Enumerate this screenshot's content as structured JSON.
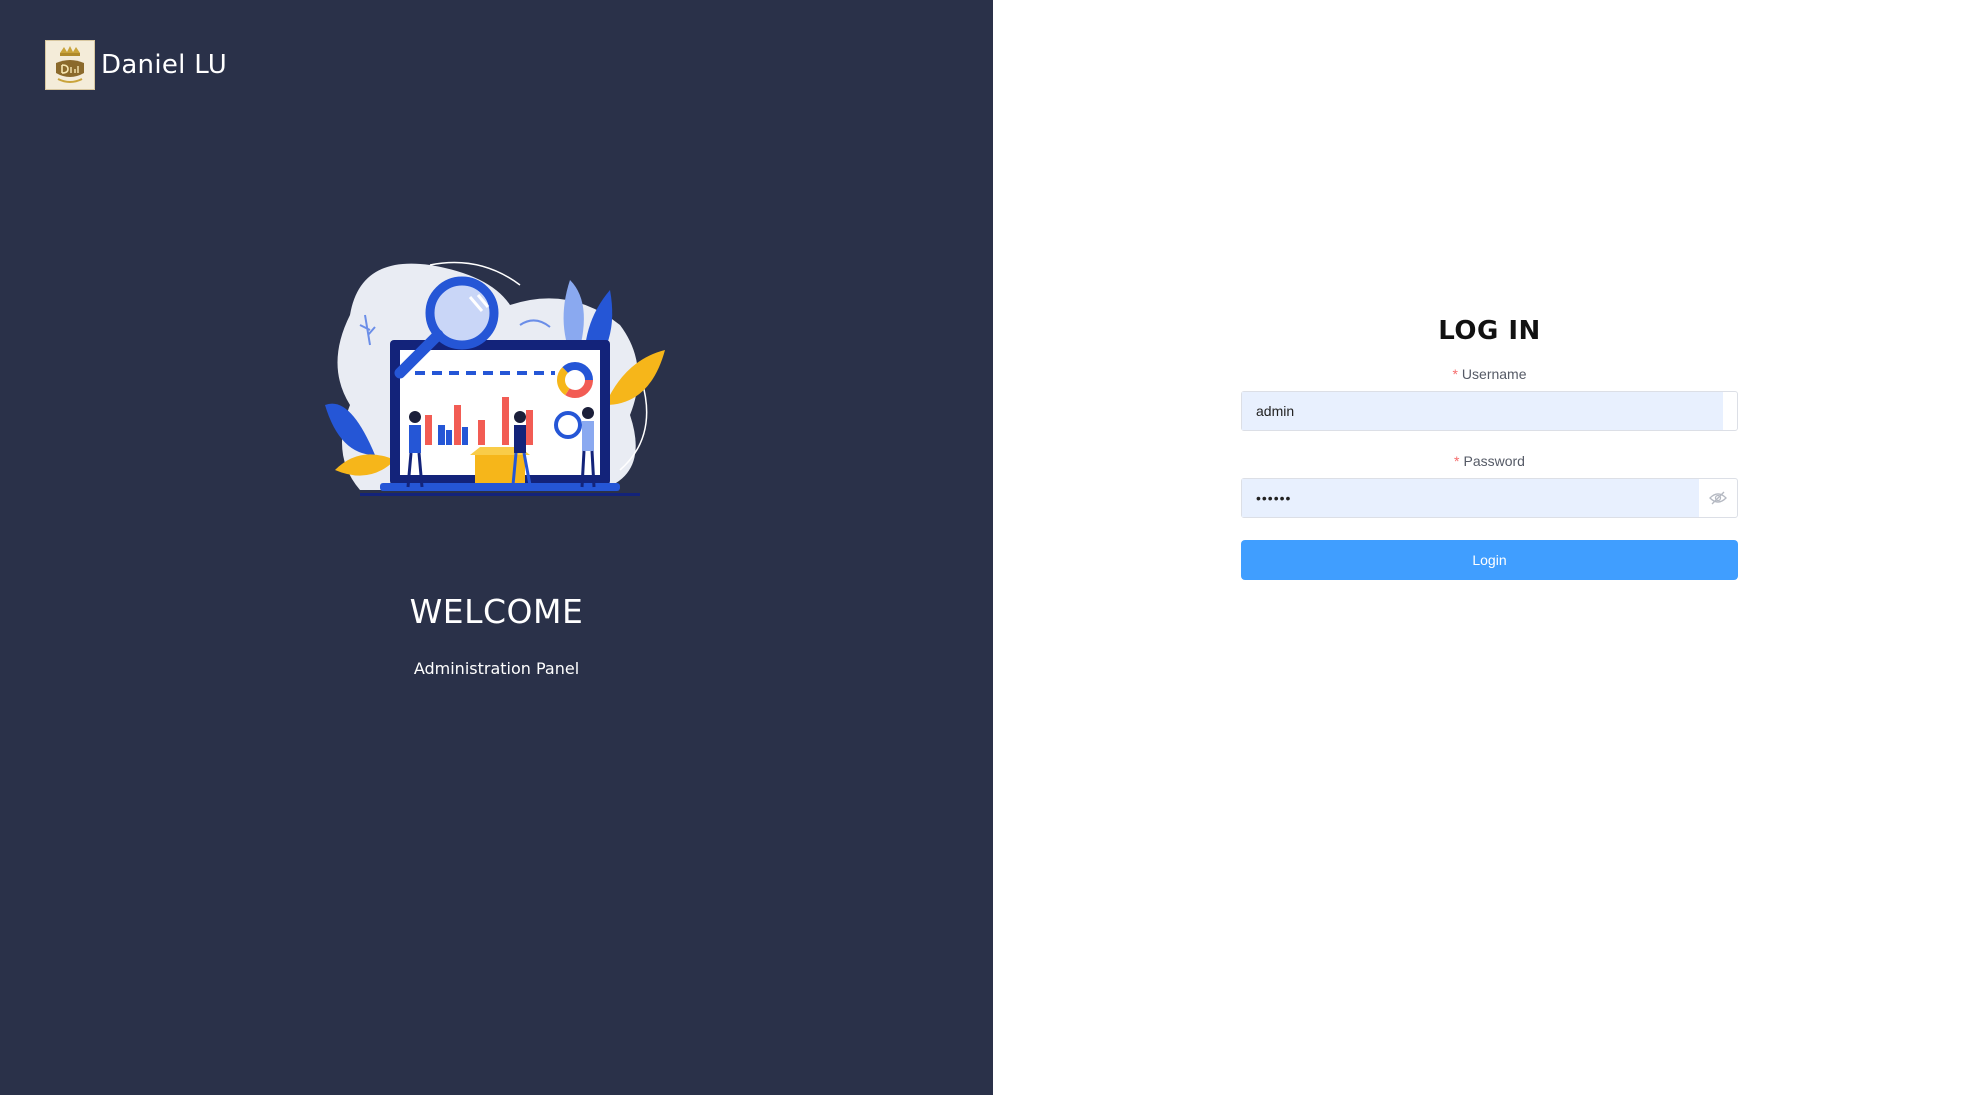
{
  "brand": {
    "logo_icon": "daniel-crest-logo",
    "name": "Daniel LU"
  },
  "hero": {
    "illustration": "analytics-dashboard-illustration",
    "welcome": "WELCOME",
    "subtitle": "Administration Panel"
  },
  "login": {
    "title": "LOG IN",
    "username": {
      "label": "Username",
      "required_mark": "*",
      "value": "admin"
    },
    "password": {
      "label": "Password",
      "required_mark": "*",
      "value": "••••••",
      "toggle_icon": "eye-hidden-icon"
    },
    "submit_label": "Login"
  },
  "colors": {
    "left_panel_bg": "#2a3149",
    "right_panel_bg": "#ffffff",
    "primary": "#409eff",
    "required": "#f56c6c",
    "autofill_bg": "#e8f0fe"
  }
}
